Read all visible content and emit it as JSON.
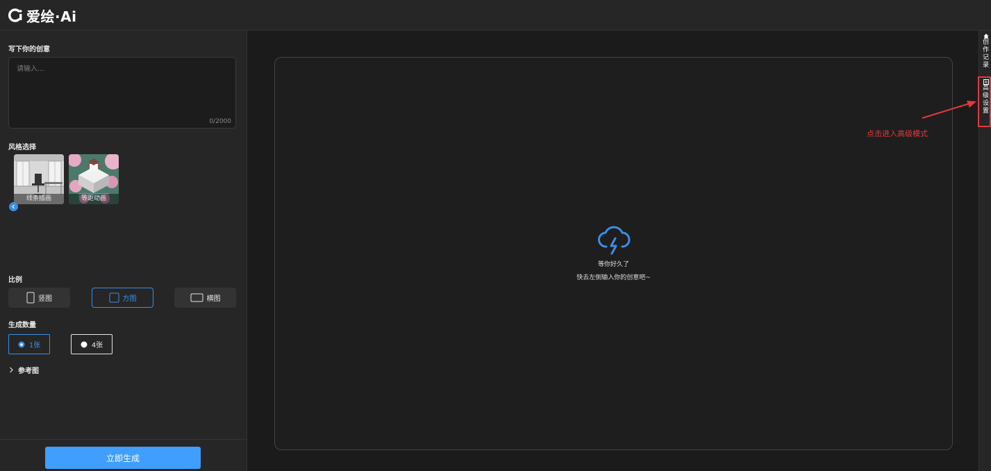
{
  "app": {
    "logo_text": "爱绘·Ai"
  },
  "left_panel": {
    "prompt_label": "写下你的创意",
    "prompt_placeholder": "请输入...",
    "prompt_value": "",
    "char_count": "0/2000",
    "style_label": "风格选择",
    "styles": [
      {
        "label": "线条插画"
      },
      {
        "label": "等距动画"
      }
    ],
    "ratio_label": "比例",
    "ratios": [
      {
        "label": "竖图",
        "selected": false
      },
      {
        "label": "方图",
        "selected": true
      },
      {
        "label": "横图",
        "selected": false
      }
    ],
    "count_label": "生成数量",
    "counts": [
      {
        "label": "1张",
        "selected": true
      },
      {
        "label": "4张",
        "selected": false
      }
    ],
    "reference_label": "参考图",
    "generate_label": "立即生成"
  },
  "canvas": {
    "empty_title": "等你好久了",
    "empty_subtitle": "快去左侧输入你的创意吧~"
  },
  "right_rail": {
    "history_chars": [
      "创",
      "作",
      "记",
      "录"
    ],
    "advanced_chars": [
      "高",
      "级",
      "设",
      "置"
    ]
  },
  "annotation": {
    "text": "点击进入高级模式"
  },
  "colors": {
    "accent": "#409eff",
    "annotation": "#e0393e",
    "panel_bg": "#262626",
    "canvas_bg": "#1e1e1e"
  }
}
